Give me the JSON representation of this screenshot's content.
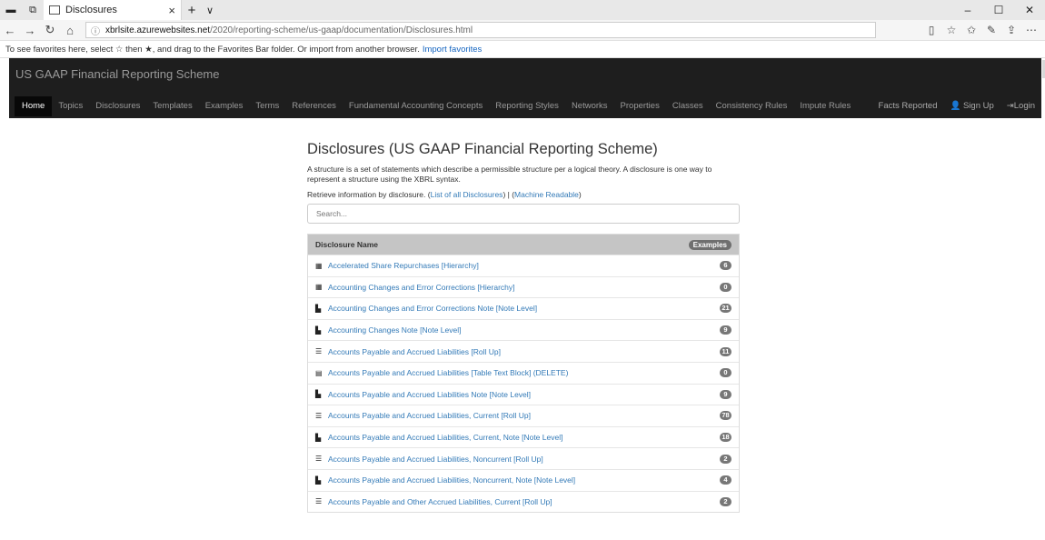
{
  "browser": {
    "tab_title": "Disclosures",
    "url_host": "xbrlsite.azurewebsites.net",
    "url_path": "/2020/reporting-scheme/us-gaap/documentation/Disclosures.html",
    "favorites_text": "To see favorites here, select ☆ then ★, and drag to the Favorites Bar folder. Or import from another browser.",
    "import_link": "Import favorites"
  },
  "site": {
    "brand": "US GAAP Financial Reporting Scheme",
    "nav": [
      "Home",
      "Topics",
      "Disclosures",
      "Templates",
      "Examples",
      "Terms",
      "References",
      "Fundamental Accounting Concepts",
      "Reporting Styles",
      "Networks",
      "Properties",
      "Classes",
      "Consistency Rules",
      "Impute Rules"
    ],
    "nav_right": [
      "Facts Reported",
      "Sign Up",
      "Login"
    ]
  },
  "content": {
    "title": "Disclosures (US GAAP Financial Reporting Scheme)",
    "desc": "A structure is a set of statements which describe a permissible structure per a logical theory. A disclosure is one way to represent a structure using the XBRL syntax.",
    "retrieve_prefix": "Retrieve information by disclosure. (",
    "list_link": "List of all Disclosures",
    "mid_sep": ") | (",
    "machine_link": "Machine Readable",
    "retrieve_suffix": ")",
    "search_placeholder": "Search...",
    "table_header": "Disclosure Name",
    "table_pill": "Examples",
    "rows": [
      {
        "icon": "grid",
        "label": "Accelerated Share Repurchases [Hierarchy]",
        "count": "6"
      },
      {
        "icon": "grid",
        "label": "Accounting Changes and Error Corrections [Hierarchy]",
        "count": "0"
      },
      {
        "icon": "file",
        "label": "Accounting Changes and Error Corrections Note [Note Level]",
        "count": "21"
      },
      {
        "icon": "file",
        "label": "Accounting Changes Note [Note Level]",
        "count": "9"
      },
      {
        "icon": "list",
        "label": "Accounts Payable and Accrued Liabilities [Roll Up]",
        "count": "11"
      },
      {
        "icon": "block",
        "label": "Accounts Payable and Accrued Liabilities [Table Text Block] (DELETE)",
        "count": "0"
      },
      {
        "icon": "file",
        "label": "Accounts Payable and Accrued Liabilities Note [Note Level]",
        "count": "9"
      },
      {
        "icon": "list",
        "label": "Accounts Payable and Accrued Liabilities, Current [Roll Up]",
        "count": "78"
      },
      {
        "icon": "file",
        "label": "Accounts Payable and Accrued Liabilities, Current, Note [Note Level]",
        "count": "18"
      },
      {
        "icon": "list",
        "label": "Accounts Payable and Accrued Liabilities, Noncurrent [Roll Up]",
        "count": "2"
      },
      {
        "icon": "file",
        "label": "Accounts Payable and Accrued Liabilities, Noncurrent, Note [Note Level]",
        "count": "4"
      },
      {
        "icon": "list",
        "label": "Accounts Payable and Other Accrued Liabilities, Current [Roll Up]",
        "count": "2"
      }
    ]
  }
}
